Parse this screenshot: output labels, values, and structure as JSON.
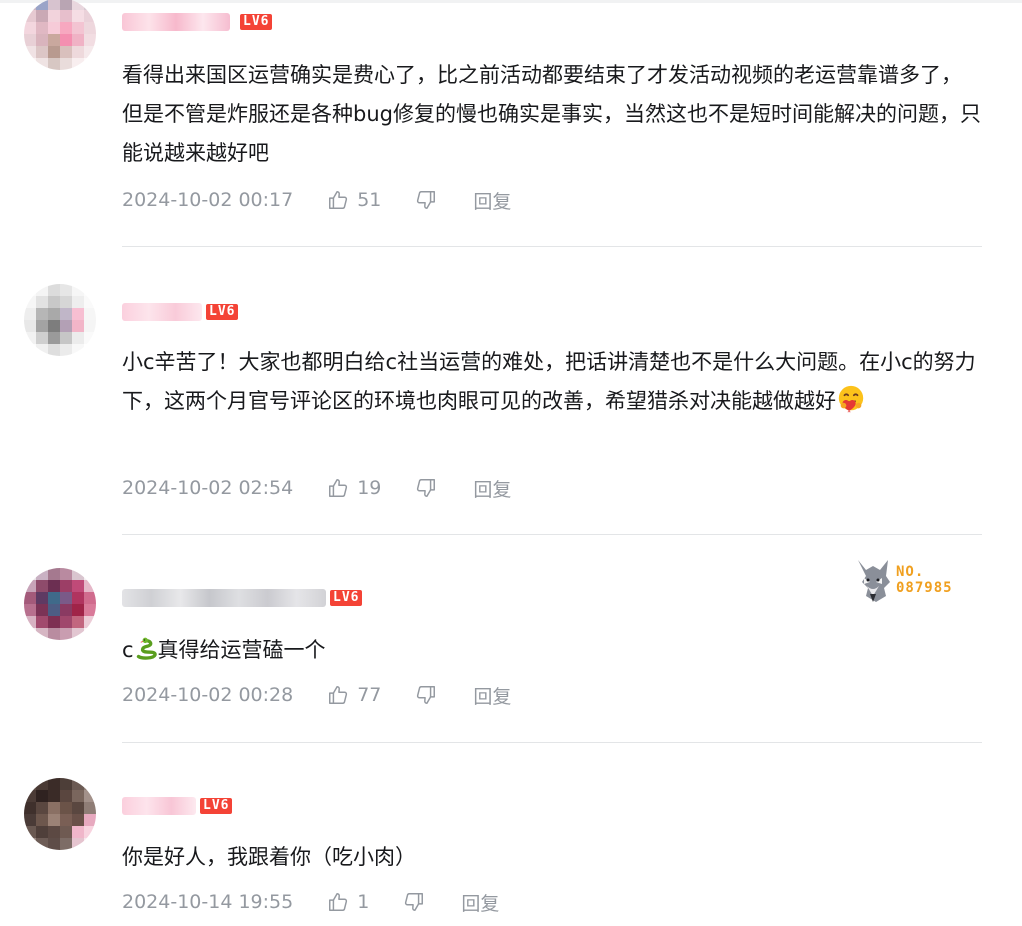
{
  "comments": [
    {
      "level_badge": "LV6",
      "text": "看得出来国区运营确实是费心了，比之前活动都要结束了才发活动视频的老运营靠谱多了，但是不管是炸服还是各种bug修复的慢也确实是事实，当然这也不是短时间能解决的问题，只能说越来越好吧",
      "time": "2024-10-02 00:17",
      "likes": "51",
      "reply_label": "回复"
    },
    {
      "level_badge": "LV6",
      "text": "小c辛苦了！大家也都明白给c社当运营的难处，把话讲清楚也不是什么大问题。在小c的努力下，这两个月官号评论区的环境也肉眼可见的改善，希望猎杀对决能越做越好",
      "time": "2024-10-02 02:54",
      "likes": "19",
      "reply_label": "回复"
    },
    {
      "level_badge": "LV6",
      "text_prefix": "c",
      "text_suffix": "真得给运营磕一个",
      "time": "2024-10-02 00:28",
      "likes": "77",
      "reply_label": "回复",
      "fan_badge": {
        "line1": "NO.",
        "line2": "087985"
      }
    },
    {
      "level_badge": "LV6",
      "text": "你是好人，我跟着你（吃小肉）",
      "time": "2024-10-14 19:55",
      "likes": "1",
      "reply_label": "回复"
    }
  ],
  "icons": {
    "like": "thumbs-up-icon",
    "dislike": "thumbs-down-icon",
    "emoji_hug": "hugging-face-emoji-icon",
    "emoji_snake": "snake-emoji-icon",
    "fan_badge": "wolf-badge-icon"
  },
  "colors": {
    "text": "#18191c",
    "meta": "#9499a0",
    "level_badge": "#f44336",
    "fan_badge": "#f0a020",
    "divider": "#e3e5e7"
  }
}
